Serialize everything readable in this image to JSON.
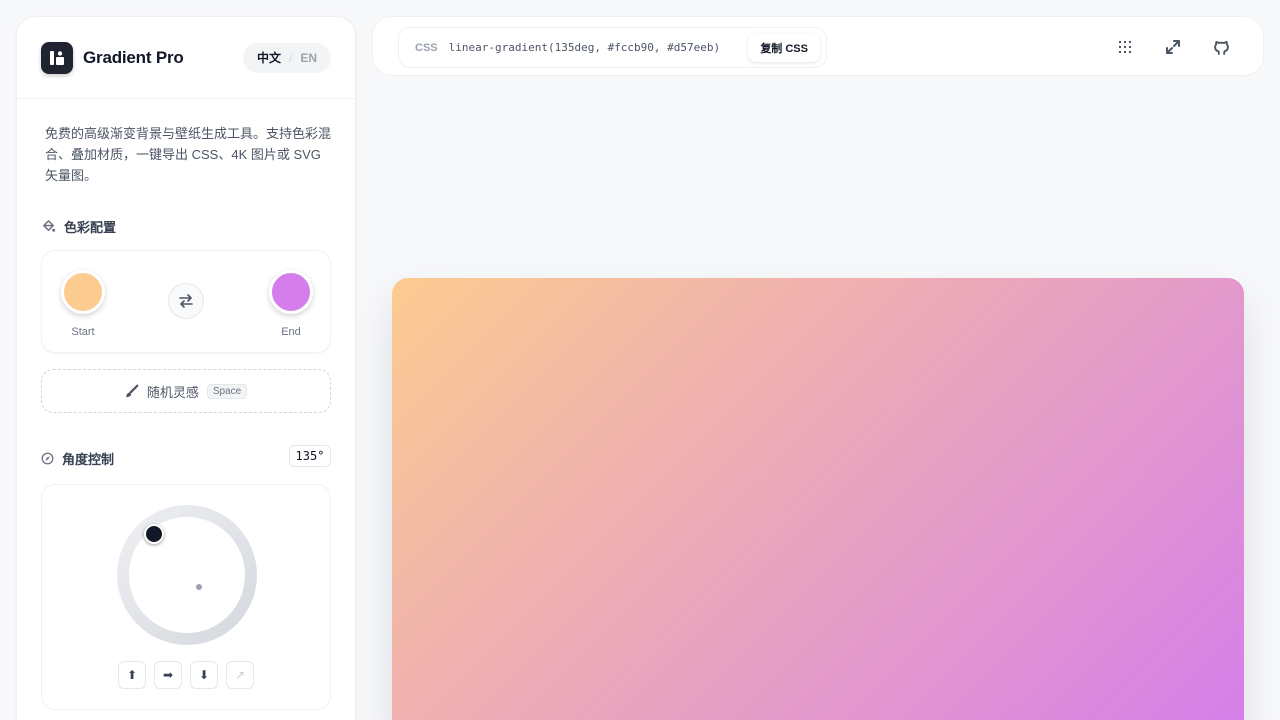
{
  "app": {
    "title": "Gradient Pro",
    "description": "免费的高级渐变背景与壁纸生成工具。支持色彩混合、叠加材质，一键导出 CSS、4K 图片或 SVG 矢量图。"
  },
  "language": {
    "active": "中文",
    "separator": "/",
    "inactive": "EN"
  },
  "colors_section": {
    "title": "色彩配置",
    "icon": "paint-bucket-icon",
    "start": {
      "label": "Start",
      "color": "#fccb90"
    },
    "end": {
      "label": "End",
      "color": "#d57eeb"
    },
    "swap_icon": "swap-arrows-icon"
  },
  "random_button": {
    "label": "随机灵感",
    "shortcut": "Space",
    "icon": "brush-icon"
  },
  "angle_section": {
    "title": "角度控制",
    "icon": "compass-icon",
    "value": "135°",
    "directions": [
      {
        "glyph": "⬆",
        "name": "up"
      },
      {
        "glyph": "➡",
        "name": "right"
      },
      {
        "glyph": "⬇",
        "name": "down"
      },
      {
        "glyph": "↗",
        "name": "up-right"
      }
    ]
  },
  "toolbar": {
    "css_tag": "CSS",
    "css_code": "linear-gradient(135deg, #fccb90, #d57eeb)",
    "copy_label": "复制 CSS",
    "icons": [
      "grid-icon",
      "expand-icon",
      "github-icon"
    ]
  },
  "preview": {
    "angle_deg": 135,
    "color_start": "#fccb90",
    "color_end": "#d57eeb"
  }
}
